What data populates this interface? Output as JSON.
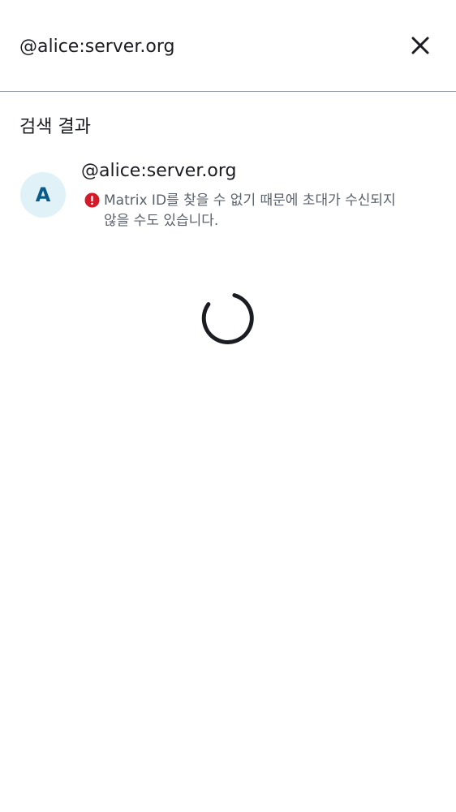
{
  "search": {
    "value": "@alice:server.org",
    "close_icon": "close-icon"
  },
  "results": {
    "section_title": "검색 결과",
    "items": [
      {
        "avatar_letter": "A",
        "name": "@alice:server.org",
        "warning_icon": "error-icon",
        "warning": "Matrix ID를 찾을 수 없기 때문에 초대가 수신되지 않을 수도 있습니다."
      }
    ]
  },
  "loading": {
    "icon": "spinner-icon"
  },
  "colors": {
    "text": "#1b1d22",
    "secondary_text": "#5b616b",
    "divider": "#8d8ea0",
    "avatar_bg": "#e0f2f7",
    "avatar_text": "#0a5a8a",
    "error": "#d51928"
  }
}
